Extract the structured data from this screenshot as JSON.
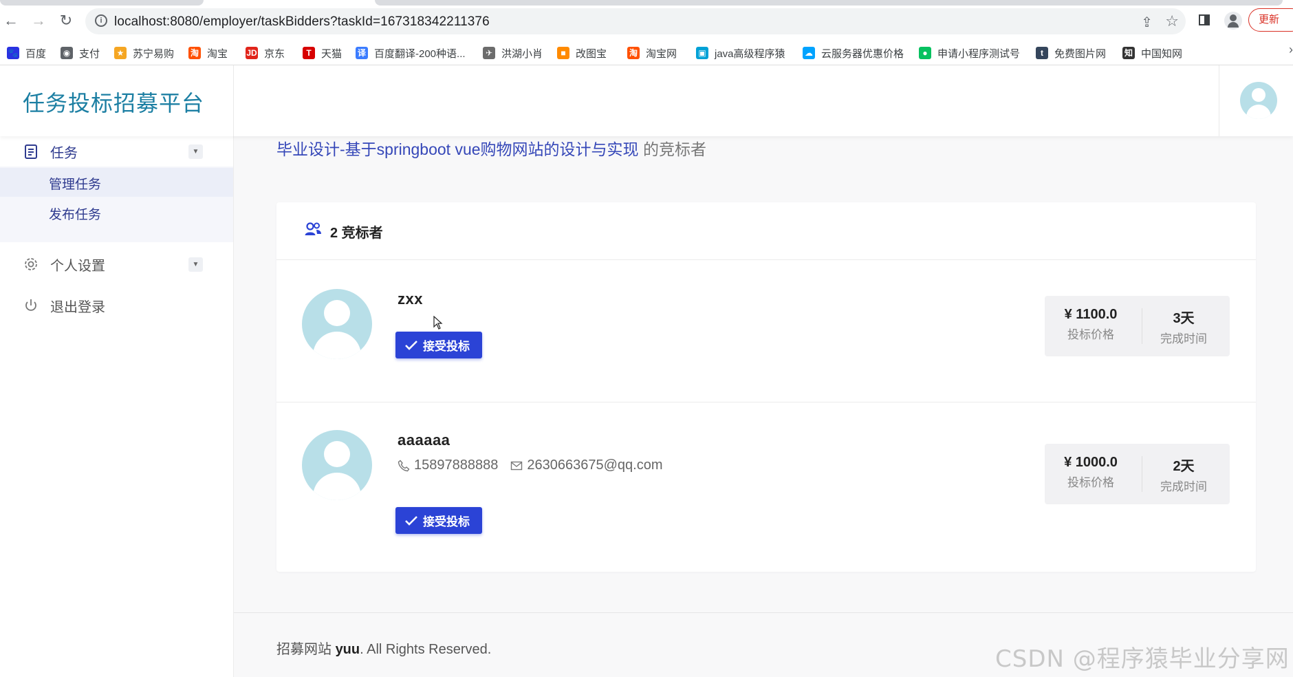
{
  "browser": {
    "url": "localhost:8080/employer/taskBidders?taskId=167318342211376",
    "update_label": "更新"
  },
  "bookmarks": [
    {
      "label": "百度",
      "icon": "baidu-icon",
      "color": "#2932e1"
    },
    {
      "label": "支付",
      "icon": "globe-icon",
      "color": "#5f6368"
    },
    {
      "label": "苏宁易购",
      "icon": "suning-icon",
      "color": "#f5a623"
    },
    {
      "label": "淘宝",
      "icon": "taobao-icon",
      "color": "#ff5000"
    },
    {
      "label": "京东",
      "icon": "jd-icon",
      "color": "#e1251b"
    },
    {
      "label": "天猫",
      "icon": "tmall-icon",
      "color": "#d70000"
    },
    {
      "label": "百度翻译-200种语...",
      "icon": "translate-icon",
      "color": "#3b7cff"
    },
    {
      "label": "洪湖小肖",
      "icon": "bird-icon",
      "color": "#6c6c6c"
    },
    {
      "label": "改图宝",
      "icon": "gaitubao-icon",
      "color": "#ff8a00"
    },
    {
      "label": "淘宝网",
      "icon": "taobao-icon",
      "color": "#ff5000"
    },
    {
      "label": "java高级程序猿",
      "icon": "bilibili-icon",
      "color": "#00a1d6"
    },
    {
      "label": "云服务器优惠价格",
      "icon": "cloud-icon",
      "color": "#00a3ff"
    },
    {
      "label": "申请小程序测试号",
      "icon": "wechat-icon",
      "color": "#07c160"
    },
    {
      "label": "免费图片网",
      "icon": "tumblr-icon",
      "color": "#35465c"
    },
    {
      "label": "中国知网",
      "icon": "cnki-icon",
      "color": "#333333"
    }
  ],
  "header": {
    "brand": "任务投标招募平台"
  },
  "sidebar": {
    "task_menu": "任务",
    "sub_items": [
      "管理任务",
      "发布任务"
    ],
    "settings_menu": "个人设置",
    "logout_menu": "退出登录"
  },
  "main": {
    "task_title": "毕业设计-基于springboot vue购物网站的设计与实现",
    "title_suffix": "的竞标者",
    "bidder_count": "2 竞标者",
    "bidders": [
      {
        "name": "zxx",
        "phone": "",
        "email": "",
        "accept_label": "接受投标",
        "price": "¥ 1100.0",
        "price_label": "投标价格",
        "days": "3天",
        "days_label": "完成时间"
      },
      {
        "name": "aaaaaa",
        "phone": "15897888888",
        "email": "2630663675@qq.com",
        "accept_label": "接受投标",
        "price": "¥ 1000.0",
        "price_label": "投标价格",
        "days": "2天",
        "days_label": "完成时间"
      }
    ]
  },
  "footer": {
    "prefix": "招募网站 ",
    "site": "yuu",
    "suffix": ". All Rights Reserved."
  },
  "watermark": "CSDN @程序猿毕业分享网",
  "colors": {
    "brand": "#1c7fa3",
    "primary": "#2b43d6",
    "avatar": "#b8dfe8"
  }
}
